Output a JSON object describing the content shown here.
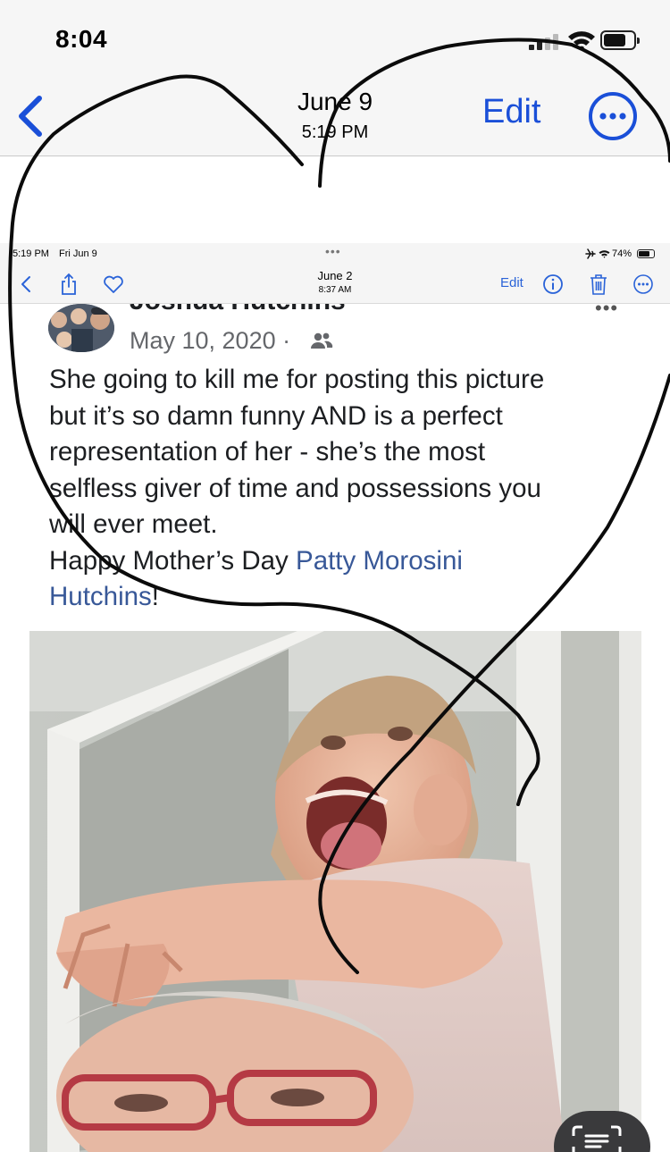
{
  "status_bar": {
    "time": "8:04",
    "signal_bars_on": 2,
    "battery_level": 0.75
  },
  "nav": {
    "back_icon": "chevron-left-icon",
    "date": "June 9",
    "time": "5:19 PM",
    "edit_label": "Edit",
    "more_icon": "ellipsis-circle-icon"
  },
  "inner": {
    "status": {
      "time": "5:19 PM",
      "date": "Fri Jun 9",
      "dots": "•••",
      "battery": "74%",
      "battery_level": 0.74
    },
    "toolbar": {
      "date": "June 2",
      "time": "8:37 AM",
      "edit_label": "Edit",
      "icons": [
        "chevron-left-icon",
        "share-icon",
        "heart-icon",
        "info-icon",
        "trash-icon",
        "ellipsis-circle-icon"
      ]
    }
  },
  "post": {
    "author": "Joshua Hutchins",
    "date": "May 10, 2020 ·",
    "more": "•••",
    "body_lines": [
      "She going to kill me for posting this picture",
      "but it’s so damn funny AND is a perfect",
      "representation of her - she’s the most",
      "selfless giver of time and possessions you",
      "will ever meet."
    ],
    "greeting_prefix": "Happy Mother’s Day ",
    "mention_line1": "Patty Morosini",
    "mention_line2": "Hutchins",
    "greeting_suffix": "!"
  },
  "colors": {
    "ios_blue": "#1a4fd8",
    "fb_link": "#385898",
    "fb_text": "#1c1e21",
    "fb_meta": "#65676b",
    "bar_bg": "#f6f6f6"
  }
}
